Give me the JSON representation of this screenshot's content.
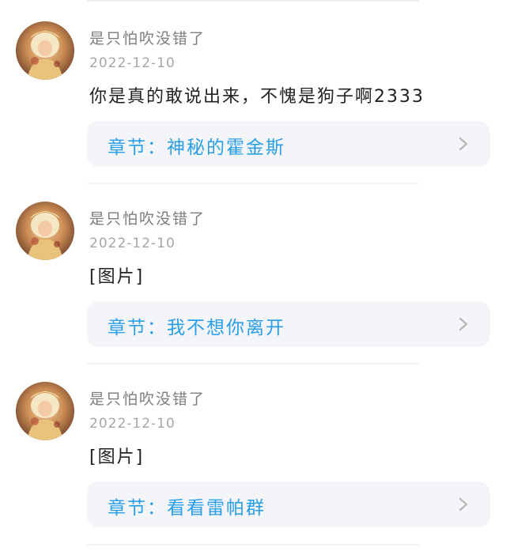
{
  "comments": [
    {
      "username": "是只怕吹没错了",
      "date": "2022-12-10",
      "content": "你是真的敢说出来，不愧是狗子啊2333",
      "chapter_prefix": "章节：",
      "chapter_title": "神秘的霍金斯"
    },
    {
      "username": "是只怕吹没错了",
      "date": "2022-12-10",
      "content": "[图片]",
      "chapter_prefix": "章节：",
      "chapter_title": "我不想你离开"
    },
    {
      "username": "是只怕吹没错了",
      "date": "2022-12-10",
      "content": "[图片]",
      "chapter_prefix": "章节：",
      "chapter_title": "看看雷帕群"
    }
  ],
  "colors": {
    "chapter_link": "#2a9ee8",
    "card_background": "#f4f5f8",
    "username": "#7c7c7c",
    "date": "#a6a6a6"
  },
  "icons": {
    "avatar": "avatar",
    "chevron": "chevron-right-icon"
  }
}
